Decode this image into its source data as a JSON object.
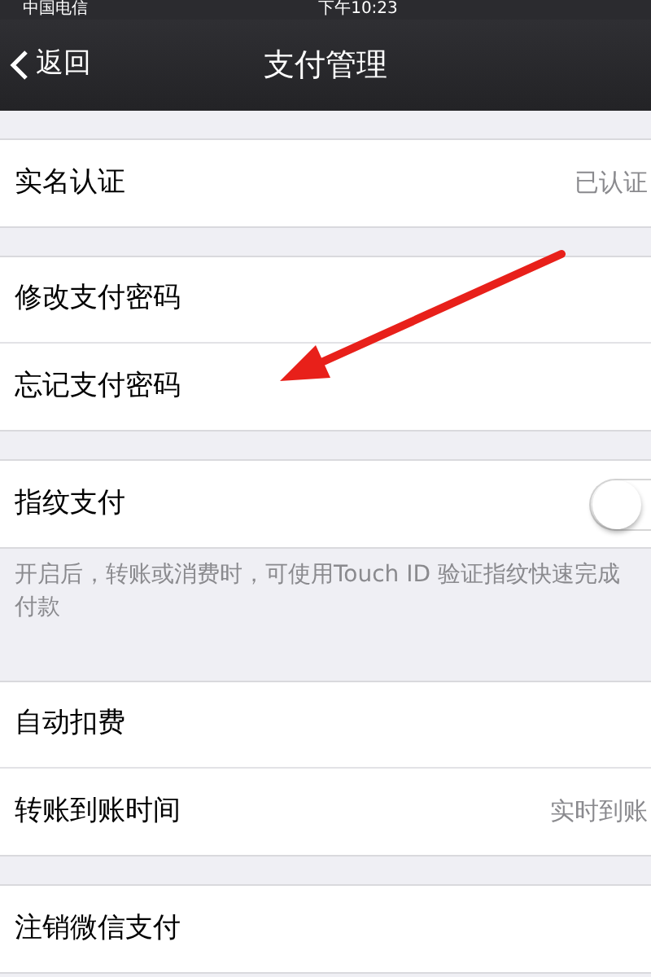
{
  "status_bar": {
    "carrier": "中国电信",
    "time": "下午10:23"
  },
  "nav_bar": {
    "back": "返回",
    "title": "支付管理"
  },
  "groups": [
    {
      "items": [
        {
          "kind": "value",
          "label": "实名认证",
          "value": "已认证"
        }
      ]
    },
    {
      "items": [
        {
          "kind": "plain",
          "label": "修改支付密码"
        },
        {
          "kind": "plain",
          "label": "忘记支付密码"
        }
      ]
    },
    {
      "items": [
        {
          "kind": "toggle",
          "label": "指纹支付",
          "on": false
        }
      ],
      "footer": "开启后，转账或消费时，可使用Touch ID 验证指纹快速完成付款"
    },
    {
      "items": [
        {
          "kind": "plain",
          "label": "自动扣费"
        },
        {
          "kind": "value",
          "label": "转账到账时间",
          "value": "实时到账"
        }
      ]
    },
    {
      "items": [
        {
          "kind": "plain",
          "label": "注销微信支付"
        }
      ]
    }
  ]
}
